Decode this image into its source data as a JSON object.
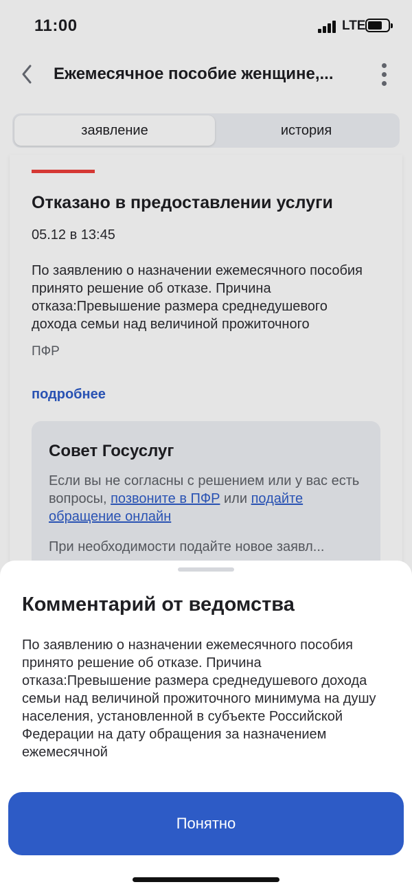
{
  "status_bar": {
    "time": "11:00",
    "network": "LTE"
  },
  "header": {
    "title": "Ежемесячное пособие женщине,..."
  },
  "tabs": [
    {
      "label": "заявление",
      "active": true
    },
    {
      "label": "история",
      "active": false
    }
  ],
  "card": {
    "status_title": "Отказано в предоставлении услуги",
    "date": "05.12 в 13:45",
    "text": "По заявлению о назначении ежемесячного пособия принято решение об отказе. Причина отказа:Превышение размера среднедушевого дохода семьи над величиной прожиточного",
    "agency": "ПФР",
    "more_link": "подробнее",
    "advice": {
      "title": "Совет Госуслуг",
      "text_before": "Если вы не согласны с решением или у вас есть вопросы, ",
      "link_call": "позвоните в ПФР",
      "text_middle": " или ",
      "link_online": "подайте обращение онлайн",
      "text_second": "При необходимости подайте новое заявл..."
    }
  },
  "sheet": {
    "title": "Комментарий от ведомства",
    "text": "По заявлению о назначении ежемесячного пособия принято решение об отказе. Причина отказа:Превышение размера среднедушевого дохода семьи над величиной прожиточного минимума на душу населения, установленной в субъекте Российской Федерации на дату обращения за назначением ежемесячной",
    "button_label": "Понятно"
  },
  "colors": {
    "accent": "#2d5bc6",
    "link": "#2e5cc8",
    "status_red": "#ee3f3a"
  }
}
